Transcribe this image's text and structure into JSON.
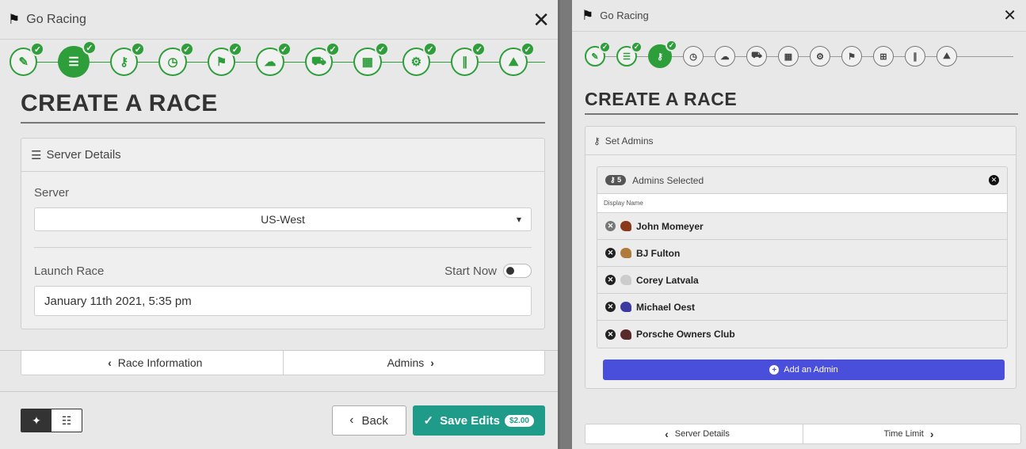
{
  "app_title": "Go Racing",
  "page_heading": "CREATE A RACE",
  "colors": {
    "step_green": "#2e9e3a",
    "save_teal": "#1f9b8a",
    "add_blue": "#4a4fdb"
  },
  "left": {
    "steps": [
      {
        "icon": "pencil-icon",
        "glyph": "✎"
      },
      {
        "icon": "server-list-icon",
        "glyph": "☰"
      },
      {
        "icon": "key-icon",
        "glyph": "⚷"
      },
      {
        "icon": "clock-icon",
        "glyph": "◷"
      },
      {
        "icon": "flag-icon",
        "glyph": "⚑"
      },
      {
        "icon": "weather-icon",
        "glyph": "☁"
      },
      {
        "icon": "car-icon",
        "glyph": "⛟"
      },
      {
        "icon": "garage-icon",
        "glyph": "▦"
      },
      {
        "icon": "car-setup-icon",
        "glyph": "⚙"
      },
      {
        "icon": "road-icon",
        "glyph": "∥"
      },
      {
        "icon": "landscape-icon",
        "glyph": "⛰"
      }
    ],
    "active_step": 1,
    "card_title": "Server Details",
    "server_label": "Server",
    "server_value": "US-West",
    "launch_label": "Launch Race",
    "start_now_label": "Start Now",
    "launch_value": "January 11th 2021, 5:35 pm",
    "prev_label": "Race Information",
    "next_label": "Admins",
    "back_label": "Back",
    "save_label": "Save Edits",
    "price": "$2.00"
  },
  "right": {
    "steps": [
      {
        "icon": "pencil-icon",
        "glyph": "✎",
        "done": true
      },
      {
        "icon": "server-list-icon",
        "glyph": "☰",
        "done": true
      },
      {
        "icon": "key-icon",
        "glyph": "⚷",
        "done": true,
        "active": true
      },
      {
        "icon": "clock-icon",
        "glyph": "◷"
      },
      {
        "icon": "weather-icon",
        "glyph": "☁"
      },
      {
        "icon": "car-icon",
        "glyph": "⛟"
      },
      {
        "icon": "garage-icon",
        "glyph": "▦"
      },
      {
        "icon": "car-setup-icon",
        "glyph": "⚙"
      },
      {
        "icon": "flag-icon",
        "glyph": "⚑"
      },
      {
        "icon": "controller-icon",
        "glyph": "⊞"
      },
      {
        "icon": "road-icon",
        "glyph": "∥"
      },
      {
        "icon": "landscape-icon",
        "glyph": "⛰"
      }
    ],
    "card_title": "Set Admins",
    "admin_count": "5",
    "admins_selected_label": "Admins Selected",
    "column_header": "Display Name",
    "admins": [
      {
        "name": "John Momeyer",
        "helmet_color": "#8a3a1a",
        "dim": true
      },
      {
        "name": "BJ Fulton",
        "helmet_color": "#b07a3a"
      },
      {
        "name": "Corey Latvala",
        "helmet_color": "#cccccc"
      },
      {
        "name": "Michael Oest",
        "helmet_color": "#3a3aa0"
      },
      {
        "name": "Porsche Owners Club",
        "helmet_color": "#5a2a2a"
      }
    ],
    "add_admin_label": "Add an Admin",
    "prev_label": "Server Details",
    "next_label": "Time Limit"
  }
}
